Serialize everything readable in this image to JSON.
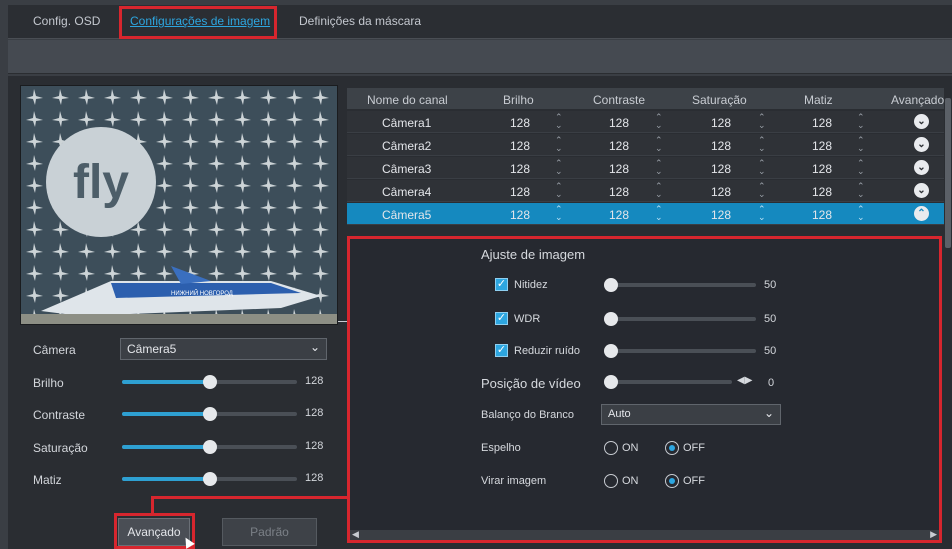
{
  "tabs": [
    {
      "label": "Config. OSD"
    },
    {
      "label": "Configurações de imagem"
    },
    {
      "label": "Definições da máscara"
    }
  ],
  "left_panel": {
    "camera_label": "Câmera",
    "camera_value": "Câmera5",
    "sliders": [
      {
        "label": "Brilho",
        "value": "128"
      },
      {
        "label": "Contraste",
        "value": "128"
      },
      {
        "label": "Saturação",
        "value": "128"
      },
      {
        "label": "Matiz",
        "value": "128"
      }
    ],
    "advanced_button": "Avançado",
    "default_button": "Padrão"
  },
  "table": {
    "headers": [
      "Nome do canal",
      "Brilho",
      "Contraste",
      "Saturação",
      "Matiz",
      "Avançado"
    ],
    "rows": [
      {
        "name": "Câmera1",
        "brilho": "128",
        "contraste": "128",
        "saturacao": "128",
        "matiz": "128"
      },
      {
        "name": "Câmera2",
        "brilho": "128",
        "contraste": "128",
        "saturacao": "128",
        "matiz": "128"
      },
      {
        "name": "Câmera3",
        "brilho": "128",
        "contraste": "128",
        "saturacao": "128",
        "matiz": "128"
      },
      {
        "name": "Câmera4",
        "brilho": "128",
        "contraste": "128",
        "saturacao": "128",
        "matiz": "128"
      },
      {
        "name": "Câmera5",
        "brilho": "128",
        "contraste": "128",
        "saturacao": "128",
        "matiz": "128"
      }
    ]
  },
  "advanced_panel": {
    "title": "Ajuste de imagem",
    "checks": [
      {
        "label": "Nitidez",
        "value": "50"
      },
      {
        "label": "WDR",
        "value": "50"
      },
      {
        "label": "Reduzir ruído",
        "value": "50"
      }
    ],
    "video_position_label": "Posição de vídeo",
    "video_position_value": "0",
    "white_balance_label": "Balanço do Branco",
    "white_balance_value": "Auto",
    "mirror_label": "Espelho",
    "flip_label": "Virar imagem",
    "on_label": "ON",
    "off_label": "OFF"
  },
  "preview": {
    "logo_text": "fly",
    "plane_text": "НИЖНИЙ НОВГОРОД"
  },
  "colors": {
    "accent": "#2da6e0",
    "selected_row": "#1589bf",
    "highlight_red": "#d7262e"
  }
}
